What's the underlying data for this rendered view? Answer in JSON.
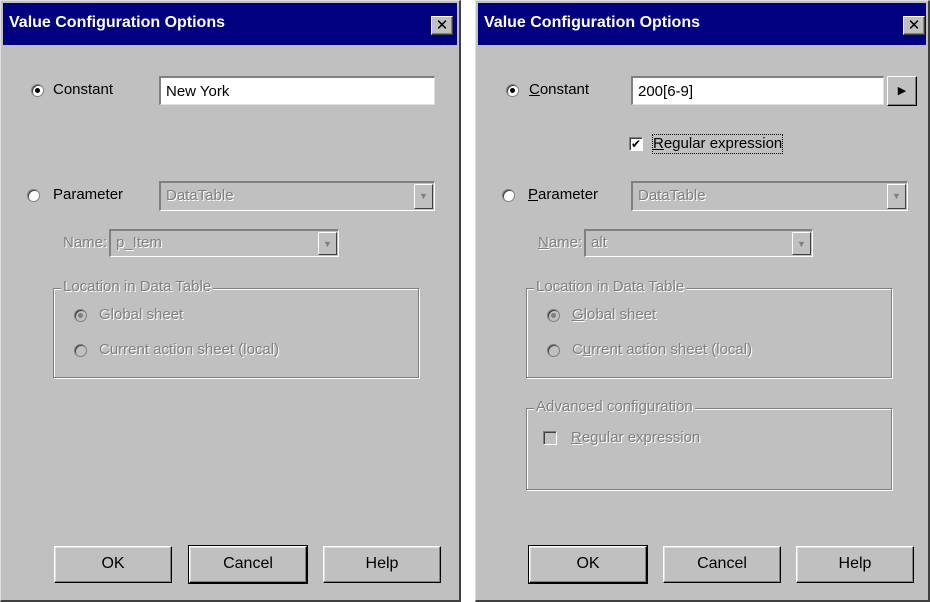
{
  "dialog_left": {
    "title": "Value Configuration Options",
    "close_glyph": "✕",
    "constant": {
      "label": "Constant",
      "value": "New York",
      "selected": true
    },
    "parameter": {
      "label": "Parameter",
      "value": "DataTable",
      "selected": false
    },
    "name": {
      "label": "Name:",
      "value": "p_Item"
    },
    "location_group": {
      "title": "Location in Data Table",
      "global": "Global sheet",
      "current": "Current action sheet (local)"
    },
    "buttons": {
      "ok": "OK",
      "cancel": "Cancel",
      "help": "Help"
    }
  },
  "dialog_right": {
    "title": "Value Configuration Options",
    "close_glyph": "✕",
    "constant": {
      "label_mnemonic": "C",
      "label_rest": "onstant",
      "value": "200[6-9]",
      "selected": true
    },
    "regex_top": {
      "label_mnemonic": "R",
      "label_rest": "egular expression",
      "checked": true
    },
    "parameter": {
      "label_mnemonic": "P",
      "label_rest": "arameter",
      "value": "DataTable",
      "selected": false
    },
    "name": {
      "label_mnemonic": "N",
      "label_rest": "ame:",
      "value": "alt"
    },
    "location_group": {
      "title": "Location in Data Table",
      "global_mnemonic": "G",
      "global_rest": "lobal sheet",
      "current_pre": "C",
      "current_mnemonic": "u",
      "current_rest": "rrent action sheet (local)"
    },
    "advanced_group": {
      "title": "Advanced configuration",
      "regex_mnemonic": "R",
      "regex_rest": "egular expression"
    },
    "buttons": {
      "ok": "OK",
      "cancel": "Cancel",
      "help": "Help"
    }
  },
  "icons": {
    "combo_arrow": "▼",
    "constant_arrow": "▶",
    "check": "✔"
  }
}
